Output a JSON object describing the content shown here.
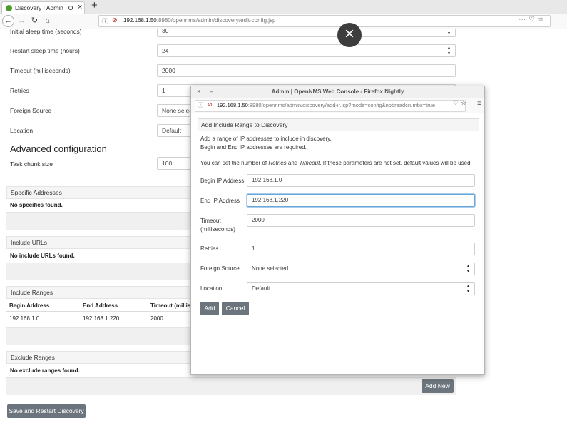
{
  "browser": {
    "tab_title": "Discovery | Admin | OpenN",
    "url_host": "192.168.1.50",
    "url_path": ":8980/opennms/admin/discovery/edit-config.jsp"
  },
  "form": {
    "initial_sleep_label": "Initial sleep time (seconds)",
    "initial_sleep_value": "30",
    "restart_sleep_label": "Restart sleep time (hours)",
    "restart_sleep_value": "24",
    "timeout_label": "Timeout (milliseconds)",
    "timeout_value": "2000",
    "retries_label": "Retries",
    "retries_value": "1",
    "foreign_source_label": "Foreign Source",
    "foreign_source_value": "None selec",
    "location_label": "Location",
    "location_value": "Default",
    "advanced_heading": "Advanced configuration",
    "task_chunk_label": "Task chunk size",
    "task_chunk_value": "100"
  },
  "panels": {
    "specific": {
      "title": "Specific Addresses",
      "empty": "No specifics found."
    },
    "urls": {
      "title": "Include URLs",
      "empty": "No include URLs found."
    },
    "ranges": {
      "title": "Include Ranges",
      "columns": [
        "Begin Address",
        "End Address",
        "Timeout (millis"
      ],
      "rows": [
        [
          "192.168.1.0",
          "192.168.1.220",
          "2000"
        ]
      ]
    },
    "exclude": {
      "title": "Exclude Ranges",
      "empty": "No exclude ranges found.",
      "add_new": "Add New"
    }
  },
  "save_button": "Save and Restart Discovery",
  "overlay_close": "×",
  "popup": {
    "window_title": "Admin | OpenNMS Web Console - Firefox Nightly",
    "url_host": "192.168.1.50",
    "url_path": ":8980/opennms/admin/discovery/add-ir.jsp?mode=config&nobreadcrumbs=true",
    "card_title": "Add Include Range to Discovery",
    "intro_1": "Add a range of IP addresses to include in discovery.",
    "intro_2": "Begin and End IP addresses are required.",
    "intro_3_pre": "You can set the number of ",
    "intro_3_retries": "Retries",
    "intro_3_and": " and ",
    "intro_3_timeout": "Timeout",
    "intro_3_post": ". If these parameters are not set, default values will be used.",
    "begin_label": "Begin IP Address",
    "begin_value": "192.168.1.0",
    "end_label": "End IP Address",
    "end_value": "192.168.1.220",
    "timeout_label_1": "Timeout",
    "timeout_label_2": "(milliseconds)",
    "timeout_value": "2000",
    "retries_label": "Retries",
    "retries_value": "1",
    "foreign_label": "Foreign Source",
    "foreign_value": "None selected",
    "location_label": "Location",
    "location_value": "Default",
    "add_button": "Add",
    "cancel_button": "Cancel"
  }
}
